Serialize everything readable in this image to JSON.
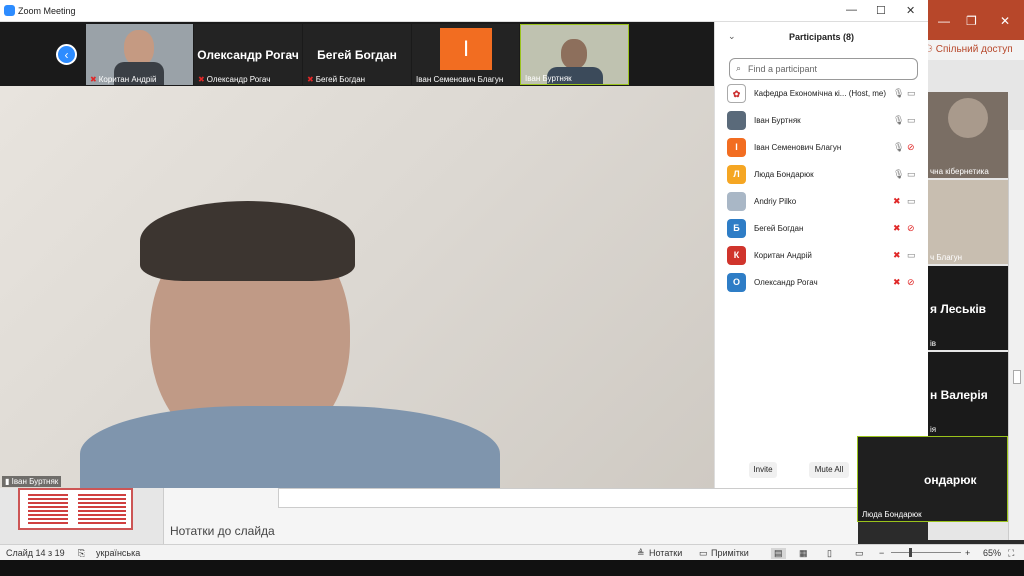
{
  "zoom": {
    "window_title": "Zoom Meeting",
    "strip": [
      {
        "name": "Коритан Андрій",
        "big": "",
        "muted": true
      },
      {
        "name": "Олександр Рогач",
        "big": "Олександр Рогач",
        "muted": true
      },
      {
        "name": "Бегей Богдан",
        "big": "Бегей Богдан",
        "muted": true
      },
      {
        "name": "Іван Семенович Благун",
        "big": "",
        "muted": false
      },
      {
        "name": "Іван Буртняк",
        "big": "",
        "muted": false
      }
    ],
    "strip_initial": "І",
    "main_speaker": "Іван Буртняк",
    "panel": {
      "title": "Participants (8)",
      "search_placeholder": "Find a participant",
      "participants": [
        {
          "initial": "",
          "name": "Кафедра Економічна кі... (Host, me)",
          "color": "#ffffff",
          "mic": "on",
          "cam": "on"
        },
        {
          "initial": "",
          "name": "Іван Буртняк",
          "color": "#5a6a7a",
          "mic": "on",
          "cam": "on"
        },
        {
          "initial": "І",
          "name": "Іван Семенович Благун",
          "color": "#f26d21",
          "mic": "on",
          "cam": "off"
        },
        {
          "initial": "Л",
          "name": "Люда Бондарюк",
          "color": "#f5a623",
          "mic": "on",
          "cam": "on"
        },
        {
          "initial": "",
          "name": "Andriy Pilko",
          "color": "#a9b7c6",
          "mic": "off",
          "cam": "on"
        },
        {
          "initial": "Б",
          "name": "Бегей Богдан",
          "color": "#2e7dc6",
          "mic": "off",
          "cam": "off"
        },
        {
          "initial": "К",
          "name": "Коритан Андрій",
          "color": "#d0342c",
          "mic": "off",
          "cam": "on"
        },
        {
          "initial": "О",
          "name": "Олександр Рогач",
          "color": "#2e7dc6",
          "mic": "off",
          "cam": "off"
        }
      ],
      "buttons": {
        "invite": "Invite",
        "mute_all": "Mute All",
        "more": "..."
      }
    },
    "float_tile": {
      "big": "ондарюк",
      "caption": "Люда Бондарюк"
    }
  },
  "powerpoint": {
    "share": "Спільний доступ",
    "notes_placeholder": "Нотатки до слайда",
    "right_tiles": [
      {
        "big": "",
        "small": "чна кібернетика"
      },
      {
        "big": "",
        "small": "ч Благун"
      },
      {
        "big": "я Леськів",
        "small": "ів"
      },
      {
        "big": "н Валерія",
        "small": "ія"
      }
    ],
    "status": {
      "slide": "Слайд 14 з 19",
      "language": "українська",
      "notes": "Нотатки",
      "comments": "Примітки",
      "zoom": "65%"
    }
  }
}
